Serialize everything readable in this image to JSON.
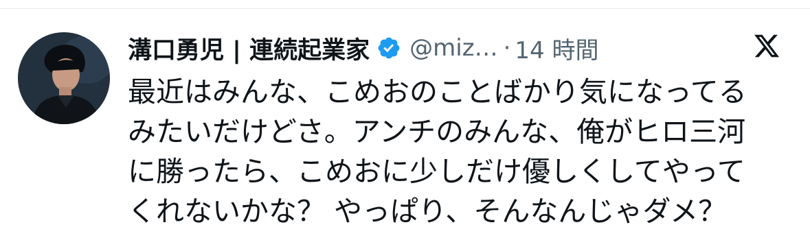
{
  "author": {
    "name": "溝口勇児 | 連続起業家",
    "handle": "@miz…",
    "separator": "·",
    "time": "14 時間",
    "verified": true
  },
  "icons": {
    "verified": "verified-badge-icon",
    "platform_logo": "x-logo-icon"
  },
  "tweet": {
    "lines": [
      "最近はみんな、こめおのことばかり気になってる",
      "みたいだけどさ。アンチのみんな、俺がヒロ三河",
      "に勝ったら、こめおに少しだけ優しくしてやって",
      "くれないかな？ やっぱり、そんなんじゃダメ？"
    ]
  },
  "colors": {
    "text": "#0f1419",
    "secondary": "#536471",
    "verified_blue": "#1d9bf0"
  }
}
